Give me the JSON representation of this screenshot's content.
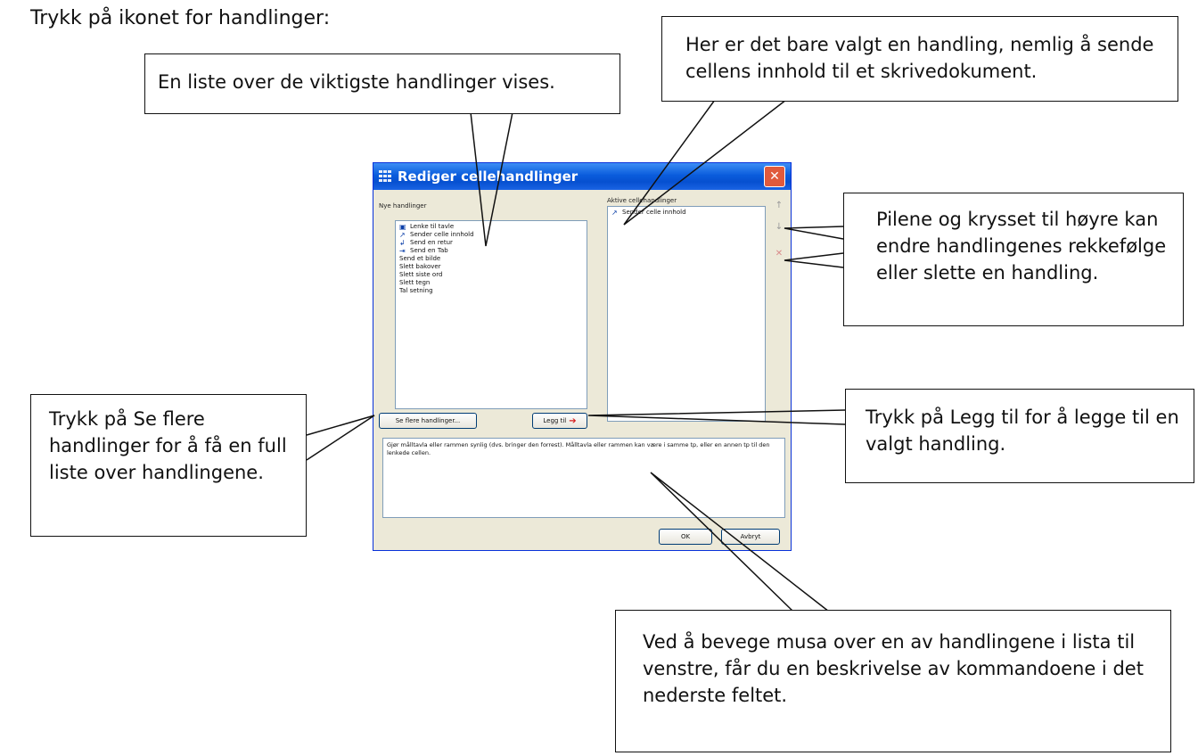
{
  "intro": "Trykk på ikonet for handlinger:",
  "callouts": {
    "list": "En liste over de viktigste handlinger vises.",
    "selected": "Her er det bare valgt en handling, nemlig å sende cellens innhold til et skrivedokument.",
    "arrows": "Pilene og krysset til høyre kan endre handlingenes rekkefølge eller slette en handling.",
    "see_more": "Trykk på Se flere handlinger for å få en full liste over handlingene.",
    "add": "Trykk på Legg til for å legge til en valgt handling.",
    "hover": "Ved å bevege musa over en av handlingene i lista til venstre, får du en beskrivelse av kommandoene i det nederste feltet."
  },
  "dialog": {
    "title": "Rediger cellehandlinger",
    "new_actions_label": "Nye handlinger",
    "active_actions_label": "Aktive cellehandlinger",
    "new_actions": [
      {
        "label": "Lenke til tavle",
        "icon": "board-link-icon",
        "glyph": "▣"
      },
      {
        "label": "Sender celle innhold",
        "icon": "send-content-icon",
        "glyph": "↗"
      },
      {
        "label": "Send en retur",
        "icon": "send-return-icon",
        "glyph": "↲"
      },
      {
        "label": "Send en Tab",
        "icon": "send-tab-icon",
        "glyph": "⇥"
      },
      {
        "label": "Send et bilde",
        "icon": "",
        "glyph": ""
      },
      {
        "label": "Slett bakover",
        "icon": "",
        "glyph": ""
      },
      {
        "label": "Slett siste ord",
        "icon": "",
        "glyph": ""
      },
      {
        "label": "Slett tegn",
        "icon": "",
        "glyph": ""
      },
      {
        "label": "Tal setning",
        "icon": "",
        "glyph": ""
      }
    ],
    "active_actions": [
      {
        "label": "Sender celle innhold",
        "icon": "send-content-icon",
        "glyph": "↗"
      }
    ],
    "see_more_button": "Se flere handlinger...",
    "add_button": "Legg til",
    "description": "Gjør målltavla eller rammen synlig (dvs. bringer den forrest). Målltavla eller rammen kan være i samme tp, eller en annen tp til den lenkede cellen.",
    "ok_button": "OK",
    "cancel_button": "Avbryt"
  }
}
